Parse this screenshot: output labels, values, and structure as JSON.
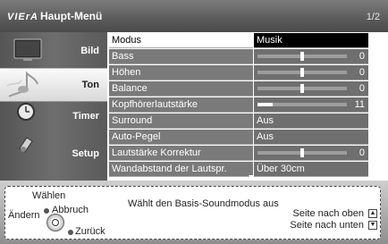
{
  "header": {
    "brand": "VIErA",
    "title": "Haupt-Menü",
    "page_indicator": "1/2"
  },
  "sidebar": {
    "items": [
      {
        "label": "Bild",
        "icon": "tv-icon"
      },
      {
        "label": "Ton",
        "icon": "music-note-icon"
      },
      {
        "label": "Timer",
        "icon": "clock-icon"
      },
      {
        "label": "Setup",
        "icon": "setup-icon"
      }
    ],
    "active": "Ton"
  },
  "menu": {
    "rows": [
      {
        "label": "Modus",
        "value": "Musik",
        "type": "option"
      },
      {
        "label": "Bass",
        "value": "0",
        "type": "slider",
        "level": 0.5
      },
      {
        "label": "Höhen",
        "value": "0",
        "type": "slider",
        "level": 0.5
      },
      {
        "label": "Balance",
        "value": "0",
        "type": "slider",
        "level": 0.5
      },
      {
        "label": "Kopfhörerlautstärke",
        "value": "11",
        "type": "fill",
        "level": 0.17
      },
      {
        "label": "Surround",
        "value": "Aus",
        "type": "option"
      },
      {
        "label": "Auto-Pegel",
        "value": "Aus",
        "type": "option"
      },
      {
        "label": "Lautstärke Korrektur",
        "value": "0",
        "type": "slider",
        "level": 0.5
      },
      {
        "label": "Wandabstand der Lautspr.",
        "value": "Über 30cm",
        "type": "option"
      }
    ],
    "selected_index": 0
  },
  "help": {
    "select_label": "Wählen",
    "change_label": "Ändern",
    "exit_label": "Abbruch",
    "back_label": "Zurück",
    "description": "Wählt den Basis-Soundmodus aus",
    "page_up": "Seite nach oben",
    "page_down": "Seite nach unten"
  },
  "colors": {
    "selected_value_bg": "#000000",
    "row_bg": "#7a7a7a",
    "header_bg": "#5a5a5a"
  }
}
